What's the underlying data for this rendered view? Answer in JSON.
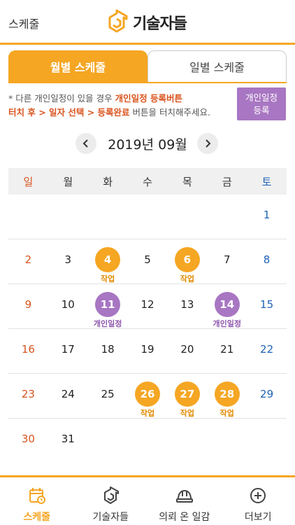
{
  "header": {
    "back_label": "스케줄",
    "logo_text": "기술자들"
  },
  "tabs": [
    {
      "label": "월별 스케줄",
      "active": true
    },
    {
      "label": "일별 스케줄",
      "active": false
    }
  ],
  "notice": {
    "prefix": "* 다른 개인일정이 있을 경우 ",
    "hl1": "개인일정 등록버튼",
    "hl2": "터치 후 > 일자 선택 > 등록완료",
    "suffix": " 버튼을 터치해주세요."
  },
  "register_button": {
    "line1": "개인일정",
    "line2": "등록"
  },
  "month_nav": {
    "label": "2019년 09월"
  },
  "weekdays": [
    "일",
    "월",
    "화",
    "수",
    "목",
    "금",
    "토"
  ],
  "weeks": [
    [
      {
        "d": ""
      },
      {
        "d": ""
      },
      {
        "d": ""
      },
      {
        "d": ""
      },
      {
        "d": ""
      },
      {
        "d": ""
      },
      {
        "d": "1"
      }
    ],
    [
      {
        "d": "2"
      },
      {
        "d": "3"
      },
      {
        "d": "4",
        "type": "work",
        "evt": "작업"
      },
      {
        "d": "5"
      },
      {
        "d": "6",
        "type": "work",
        "evt": "작업"
      },
      {
        "d": "7"
      },
      {
        "d": "8"
      }
    ],
    [
      {
        "d": "9"
      },
      {
        "d": "10"
      },
      {
        "d": "11",
        "type": "personal",
        "evt": "개인일정"
      },
      {
        "d": "12"
      },
      {
        "d": "13"
      },
      {
        "d": "14",
        "type": "personal",
        "evt": "개인일정"
      },
      {
        "d": "15"
      }
    ],
    [
      {
        "d": "16"
      },
      {
        "d": "17"
      },
      {
        "d": "18"
      },
      {
        "d": "19"
      },
      {
        "d": "20"
      },
      {
        "d": "21"
      },
      {
        "d": "22"
      }
    ],
    [
      {
        "d": "23"
      },
      {
        "d": "24"
      },
      {
        "d": "25"
      },
      {
        "d": "26",
        "type": "work",
        "evt": "작업"
      },
      {
        "d": "27",
        "type": "work",
        "evt": "작업"
      },
      {
        "d": "28",
        "type": "work",
        "evt": "작업"
      },
      {
        "d": "29"
      }
    ],
    [
      {
        "d": "30"
      },
      {
        "d": "31"
      },
      {
        "d": ""
      },
      {
        "d": ""
      },
      {
        "d": ""
      },
      {
        "d": ""
      },
      {
        "d": ""
      }
    ]
  ],
  "bottom_nav": [
    {
      "label": "스케줄",
      "icon": "calendar-icon",
      "active": true
    },
    {
      "label": "기술자들",
      "icon": "logo-icon",
      "active": false
    },
    {
      "label": "의뢰 온 일감",
      "icon": "hardhat-icon",
      "active": false
    },
    {
      "label": "더보기",
      "icon": "plus-circle-icon",
      "active": false
    }
  ],
  "colors": {
    "accent": "#f5a623",
    "personal": "#a876c2",
    "sunday": "#d9541e",
    "saturday": "#1f62b5"
  }
}
